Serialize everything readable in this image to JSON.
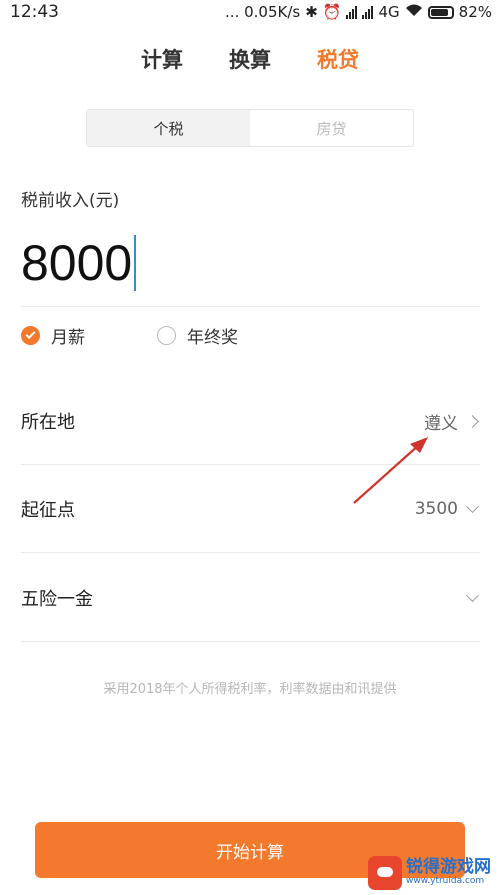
{
  "status_bar": {
    "time": "12:43",
    "net_speed": "... 0.05K/s",
    "network_type": "4G",
    "battery_percent": "82%",
    "icons": [
      "bluetooth-icon",
      "alarm-icon",
      "signal-icon",
      "signal-icon",
      "wifi-icon",
      "battery-icon"
    ]
  },
  "top_tabs": [
    {
      "label": "计算",
      "active": false
    },
    {
      "label": "换算",
      "active": false
    },
    {
      "label": "税贷",
      "active": true
    }
  ],
  "segment": {
    "tabs": [
      {
        "label": "个税",
        "active": true
      },
      {
        "label": "房贷",
        "active": false
      }
    ]
  },
  "income": {
    "label": "税前收入(元)",
    "value": "8000"
  },
  "salary_type": {
    "options": [
      {
        "label": "月薪",
        "checked": true
      },
      {
        "label": "年终奖",
        "checked": false
      }
    ]
  },
  "location": {
    "label": "所在地",
    "value": "遵义"
  },
  "threshold": {
    "label": "起征点",
    "value": "3500"
  },
  "insurance": {
    "label": "五险一金",
    "value": ""
  },
  "note": "采用2018年个人所得税利率，利率数据由和讯提供",
  "start_button": {
    "label": "开始计算"
  },
  "watermark": {
    "cn": "锐得游戏网",
    "en": "www.ytruida.com"
  },
  "colors": {
    "accent": "#f37a2d",
    "annotation_arrow": "#d0342c",
    "cursor": "#2e8fd6"
  }
}
